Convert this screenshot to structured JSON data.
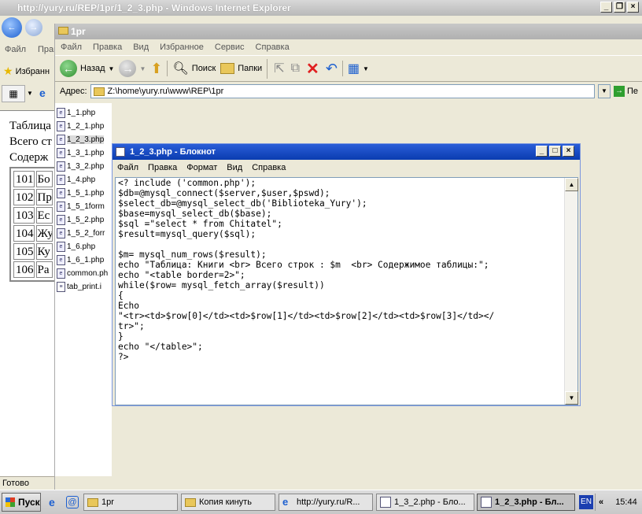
{
  "ie": {
    "title": "http://yury.ru/REP/1pr/1_2_3.php - Windows Internet Explorer",
    "menu_file": "Файл",
    "menu_view": "Прав",
    "favorites": "Избранн",
    "status": "Готово",
    "page_lines": [
      "Таблица",
      "Всего ст",
      "Содерж"
    ],
    "table": [
      {
        "id": "101",
        "v": "Бо"
      },
      {
        "id": "102",
        "v": "Пр"
      },
      {
        "id": "103",
        "v": "Ес"
      },
      {
        "id": "104",
        "v": "Жу"
      },
      {
        "id": "105",
        "v": "Ку"
      },
      {
        "id": "106",
        "v": "Ра"
      }
    ]
  },
  "explorer": {
    "title": "1pr",
    "menu": [
      "Файл",
      "Правка",
      "Вид",
      "Избранное",
      "Сервис",
      "Справка"
    ],
    "back_label": "Назад",
    "search_label": "Поиск",
    "folders_label": "Папки",
    "address_label": "Адрес:",
    "address_value": "Z:\\home\\yury.ru\\www\\REP\\1pr",
    "go_label": "Пе",
    "files": [
      "1_1.php",
      "1_2_1.php",
      "1_2_3.php",
      "1_3_1.php",
      "1_3_2.php",
      "1_4.php",
      "1_5_1.php",
      "1_5_1form",
      "1_5_2.php",
      "1_5_2_forr",
      "1_6.php",
      "1_6_1.php",
      "common.ph",
      "tab_print.i"
    ],
    "selected_index": 2
  },
  "notepad": {
    "title": "1_2_3.php - Блокнот",
    "menu": [
      "Файл",
      "Правка",
      "Формат",
      "Вид",
      "Справка"
    ],
    "content": "<? include ('common.php');\n$db=@mysql_connect($server,$user,$pswd);\n$select_db=@mysql_select_db('Biblioteka_Yury');\n$base=mysql_select_db($base);\n$sql =\"select * from Chitatel\";\n$result=mysql_query($sql);\n\n$m= mysql_num_rows($result);\necho \"Таблица: Книги <br> Всего строк : $m  <br> Содержимое таблицы:\";\necho \"<table border=2>\";\nwhile($row= mysql_fetch_array($result))\n{\nEcho\n\"<tr><td>$row[0]</td><td>$row[1]</td><td>$row[2]</td><td>$row[3]</td></\ntr>\";\n}\necho \"</table>\";\n?>"
  },
  "taskbar": {
    "start": "Пуск",
    "tasks": [
      "1pr",
      "Копия кинуть",
      "http://yury.ru/R...",
      "1_3_2.php - Бло...",
      "1_2_3.php - Бл..."
    ],
    "lang": "EN",
    "clock": "15:44"
  }
}
